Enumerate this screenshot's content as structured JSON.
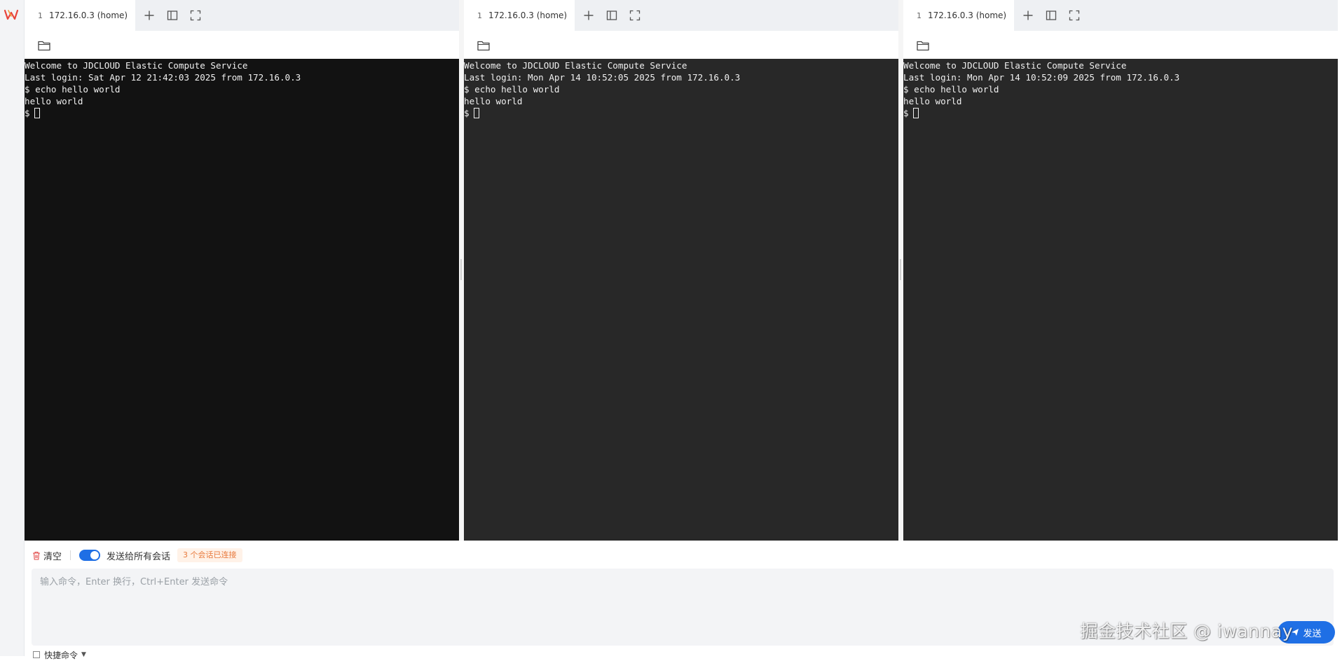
{
  "app": {
    "logo_icon": "app-logo-w-icon",
    "brand_color": "#e8453c"
  },
  "panes": [
    {
      "tab_number": "1",
      "tab_title": "172.16.0.3 (home)",
      "lines": [
        "Welcome to JDCLOUD Elastic Compute Service",
        "Last login: Sat Apr 12 21:42:03 2025 from 172.16.0.3",
        "$ echo hello world",
        "hello world"
      ],
      "prompt": "$"
    },
    {
      "tab_number": "1",
      "tab_title": "172.16.0.3 (home)",
      "lines": [
        "Welcome to JDCLOUD Elastic Compute Service",
        "Last login: Mon Apr 14 10:52:05 2025 from 172.16.0.3",
        "$ echo hello world",
        "hello world"
      ],
      "prompt": "$"
    },
    {
      "tab_number": "1",
      "tab_title": "172.16.0.3 (home)",
      "lines": [
        "Welcome to JDCLOUD Elastic Compute Service",
        "Last login: Mon Apr 14 10:52:09 2025 from 172.16.0.3",
        "$ echo hello world",
        "hello world"
      ],
      "prompt": "$"
    }
  ],
  "toolbar": {
    "clear_label": "清空",
    "broadcast_label": "发送给所有会话",
    "broadcast_enabled": true,
    "connected_badge": "3 个会话已连接"
  },
  "input": {
    "placeholder": "输入命令，Enter 换行，Ctrl+Enter 发送命令",
    "value": ""
  },
  "send": {
    "label": "发送"
  },
  "quick": {
    "label": "快捷命令"
  },
  "watermark": "掘金技术社区 @ iwannay",
  "colors": {
    "accent": "#1f6fe5",
    "terminal_bg_1": "#121212",
    "terminal_bg_2": "#282828",
    "badge_text": "#e8793c"
  }
}
